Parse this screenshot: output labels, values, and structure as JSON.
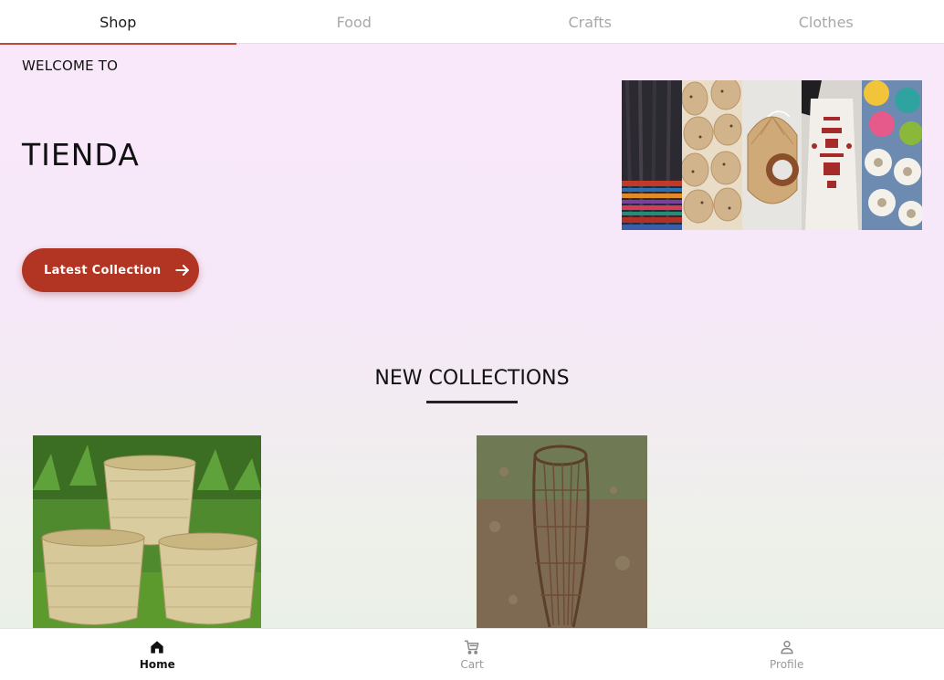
{
  "tabs": [
    {
      "label": "Shop",
      "active": true
    },
    {
      "label": "Food",
      "active": false
    },
    {
      "label": "Crafts",
      "active": false
    },
    {
      "label": "Clothes",
      "active": false
    }
  ],
  "hero": {
    "welcome": "WELCOME TO",
    "brand": "TIENDA",
    "cta_label": "Latest Collection",
    "cta_icon": "arrow-right-icon"
  },
  "collage": [
    "woven-textile",
    "cork-coasters",
    "wicker-fan",
    "embroidered-blouse",
    "beaded-coasters"
  ],
  "section": {
    "title": "NEW COLLECTIONS"
  },
  "products": [
    {
      "image": "bamboo-baskets"
    },
    {
      "image": "wicker-fish-trap"
    }
  ],
  "bottom_nav": [
    {
      "label": "Home",
      "icon": "home-icon",
      "active": true
    },
    {
      "label": "Cart",
      "icon": "cart-icon",
      "active": false
    },
    {
      "label": "Profile",
      "icon": "person-icon",
      "active": false
    }
  ],
  "colors": {
    "accent": "#b23422",
    "tab_indicator": "#c0483a",
    "background_top": "#f9e8fb",
    "background_bottom": "#e8f1e6"
  }
}
